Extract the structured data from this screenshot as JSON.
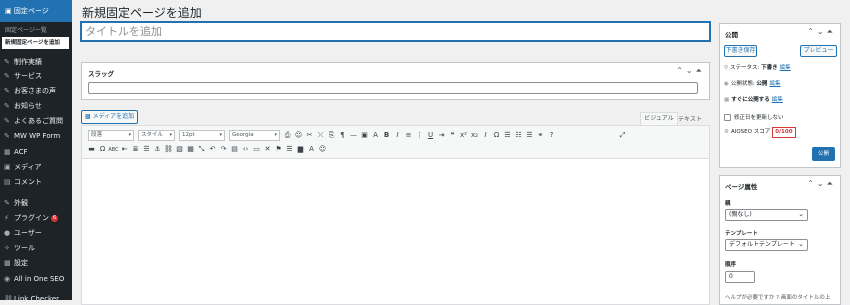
{
  "sidebar": {
    "active": "固定ページ",
    "sub_items": [
      "固定ページ一覧",
      "新規固定ページを追加"
    ],
    "items": [
      {
        "icon": "pin-icon",
        "label": "制作実績"
      },
      {
        "icon": "pin-icon",
        "label": "サービス"
      },
      {
        "icon": "pin-icon",
        "label": "お客さまの声"
      },
      {
        "icon": "pin-icon",
        "label": "お知らせ"
      },
      {
        "icon": "pin-icon",
        "label": "よくあるご質問"
      },
      {
        "icon": "pin-icon",
        "label": "MW WP Form"
      },
      {
        "icon": "grid-icon",
        "label": "ACF"
      },
      {
        "icon": "media-icon",
        "label": "メディア"
      },
      {
        "icon": "comment-icon",
        "label": "コメント"
      },
      {
        "icon": "brush-icon",
        "label": "外観"
      },
      {
        "icon": "plugin-icon",
        "label": "プラグイン",
        "badge": "6"
      },
      {
        "icon": "user-icon",
        "label": "ユーザー"
      },
      {
        "icon": "wrench-icon",
        "label": "ツール"
      },
      {
        "icon": "settings-icon",
        "label": "設定"
      },
      {
        "icon": "seo-icon",
        "label": "All in One SEO"
      },
      {
        "icon": "link-icon",
        "label": "Link Checker"
      }
    ]
  },
  "page": {
    "title": "新規固定ページを追加",
    "title_placeholder": "タイトルを追加"
  },
  "slug": {
    "title": "スラッグ",
    "value": ""
  },
  "editor": {
    "media_button": "メディアを追加",
    "tab_visual": "ビジュアル",
    "tab_text": "テキスト",
    "format_select": "段落",
    "style_select": "スタイル",
    "size_select": "12pt",
    "font_select": "Georgia"
  },
  "publish": {
    "title": "公開",
    "save_draft": "下書き保存",
    "preview": "プレビュー",
    "status_label": "ステータス:",
    "status_value": "下書き",
    "visibility_label": "公開状態:",
    "visibility_value": "公開",
    "schedule_label": "すぐに公開する",
    "edit_link": "編集",
    "no_update_date": "修正日を更新しない",
    "seo_label": "AIOSEO スコア",
    "seo_score": "0/100",
    "publish_button": "公開"
  },
  "page_attributes": {
    "title": "ページ属性",
    "parent_label": "親",
    "parent_value": "(親なし)",
    "template_label": "テンプレート",
    "template_value": "デフォルトテンプレート",
    "order_label": "順序",
    "order_value": "0",
    "help_text": "ヘルプが必要ですか ? 画面のタイトルの上"
  },
  "colors": {
    "accent": "#2271b1",
    "sidebar_bg": "#1d2327",
    "alert": "#d63638"
  }
}
